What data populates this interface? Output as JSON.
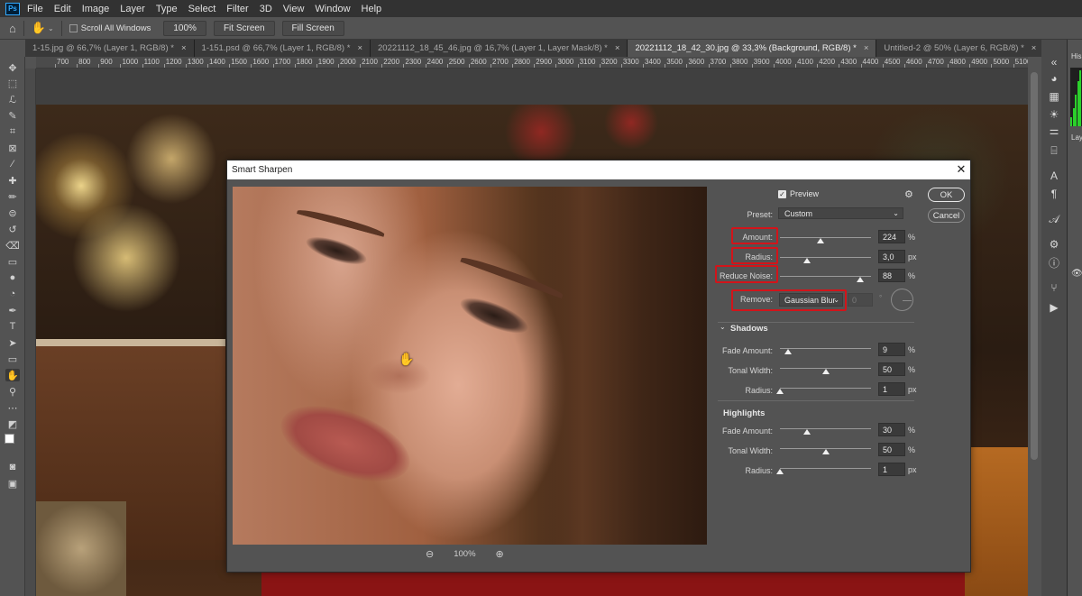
{
  "menu": [
    "File",
    "Edit",
    "Image",
    "Layer",
    "Type",
    "Select",
    "Filter",
    "3D",
    "View",
    "Window",
    "Help"
  ],
  "app_logo": "Ps",
  "options": {
    "scroll_all_windows": "Scroll All Windows",
    "zoom_value": "100%",
    "fit_screen": "Fit Screen",
    "fill_screen": "Fill Screen"
  },
  "tabs": [
    {
      "label": "1-15.jpg @ 66,7% (Layer 1, RGB/8) *",
      "active": false
    },
    {
      "label": "1-151.psd @ 66,7% (Layer 1, RGB/8) *",
      "active": false
    },
    {
      "label": "20221112_18_45_46.jpg @ 16,7% (Layer 1, Layer Mask/8) *",
      "active": false
    },
    {
      "label": "20221112_18_42_30.jpg @ 33,3% (Background, RGB/8) *",
      "active": true
    },
    {
      "label": "Untitled-2 @ 50% (Layer 6, RGB/8) *",
      "active": false
    }
  ],
  "ruler_ticks": [
    "700",
    "800",
    "900",
    "1000",
    "1100",
    "1200",
    "1300",
    "1400",
    "1500",
    "1600",
    "1700",
    "1800",
    "1900",
    "2000",
    "2100",
    "2200",
    "2300",
    "2400",
    "2500",
    "2600",
    "2700",
    "2800",
    "2900",
    "3000",
    "3100",
    "3200",
    "3300",
    "3400",
    "3500",
    "3600",
    "3700",
    "3800",
    "3900",
    "4000",
    "4100",
    "4200",
    "4300",
    "4400",
    "4500",
    "4600",
    "4700",
    "4800",
    "4900",
    "5000",
    "5100",
    "5200"
  ],
  "right_panel": {
    "history_tab": "His",
    "layers_tab": "Lay"
  },
  "dialog": {
    "title": "Smart Sharpen",
    "preview_label": "Preview",
    "preview_checked": true,
    "ok": "OK",
    "cancel": "Cancel",
    "preset_label": "Preset:",
    "preset_value": "Custom",
    "amount": {
      "label": "Amount:",
      "value": "224",
      "unit": "%",
      "level": 0.45
    },
    "radius": {
      "label": "Radius:",
      "value": "3,0",
      "unit": "px",
      "level": 0.3
    },
    "reduce_noise": {
      "label": "Reduce Noise:",
      "value": "88",
      "unit": "%",
      "level": 0.88
    },
    "remove": {
      "label": "Remove:",
      "value": "Gaussian Blur",
      "angle": "0",
      "degree_symbol": "°"
    },
    "shadows": {
      "header": "Shadows",
      "fade_amount": {
        "label": "Fade Amount:",
        "value": "9",
        "unit": "%",
        "level": 0.09
      },
      "tonal_width": {
        "label": "Tonal Width:",
        "value": "50",
        "unit": "%",
        "level": 0.5
      },
      "radius": {
        "label": "Radius:",
        "value": "1",
        "unit": "px",
        "level": 0.0
      }
    },
    "highlights": {
      "header": "Highlights",
      "fade_amount": {
        "label": "Fade Amount:",
        "value": "30",
        "unit": "%",
        "level": 0.3
      },
      "tonal_width": {
        "label": "Tonal Width:",
        "value": "50",
        "unit": "%",
        "level": 0.5
      },
      "radius": {
        "label": "Radius:",
        "value": "1",
        "unit": "px",
        "level": 0.0
      }
    },
    "zoom": "100%"
  }
}
